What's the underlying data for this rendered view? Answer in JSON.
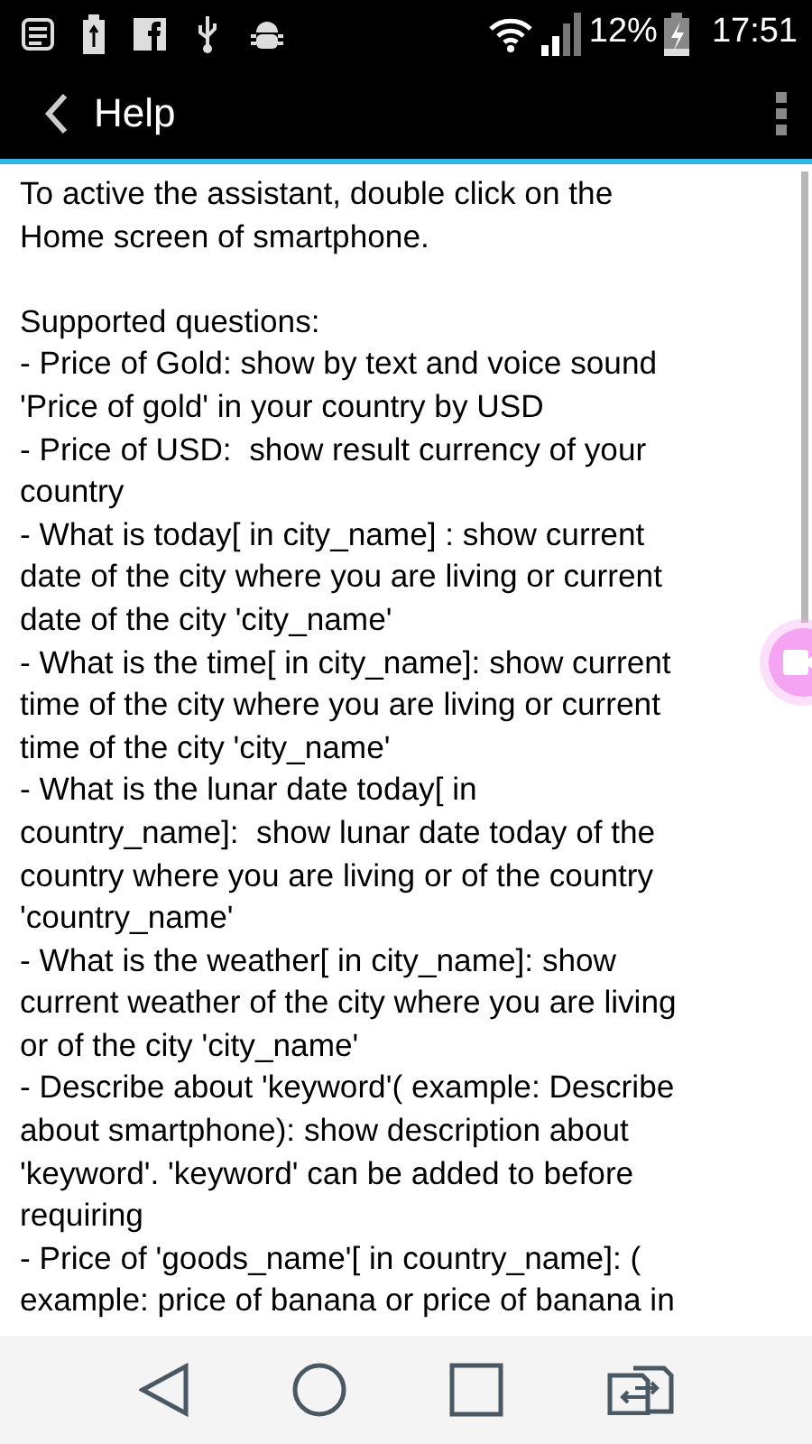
{
  "status_bar": {
    "battery_percent": "12%",
    "time": "17:51"
  },
  "toolbar": {
    "title": "Help"
  },
  "paragraphs": [
    "To active the assistant, double click on the\nHome screen of smartphone.",
    "Supported questions:\n- Price of Gold: show by text and voice sound\n'Price of gold' in your country by USD",
    "- Price of USD:  show result currency of your\ncountry",
    "- What is today[ in city_name] : show current\ndate of the city where you are living or current\ndate of the city 'city_name'",
    "- What is the time[ in city_name]: show current\ntime of the city where you are living or current\ntime of the city 'city_name'",
    "- What is the lunar date today[ in\ncountry_name]:  show lunar date today of the\ncountry where you are living or of the country\n'country_name'",
    "- What is the weather[ in city_name]: show\ncurrent weather of the city where you are living\nor of the city 'city_name'",
    "- Describe about 'keyword'( example: Describe\nabout smartphone): show description about\n'keyword'. 'keyword' can be added to before\nrequiring",
    "- Price of 'goods_name'[ in country_name]: (\nexample: price of banana or price of banana in"
  ]
}
